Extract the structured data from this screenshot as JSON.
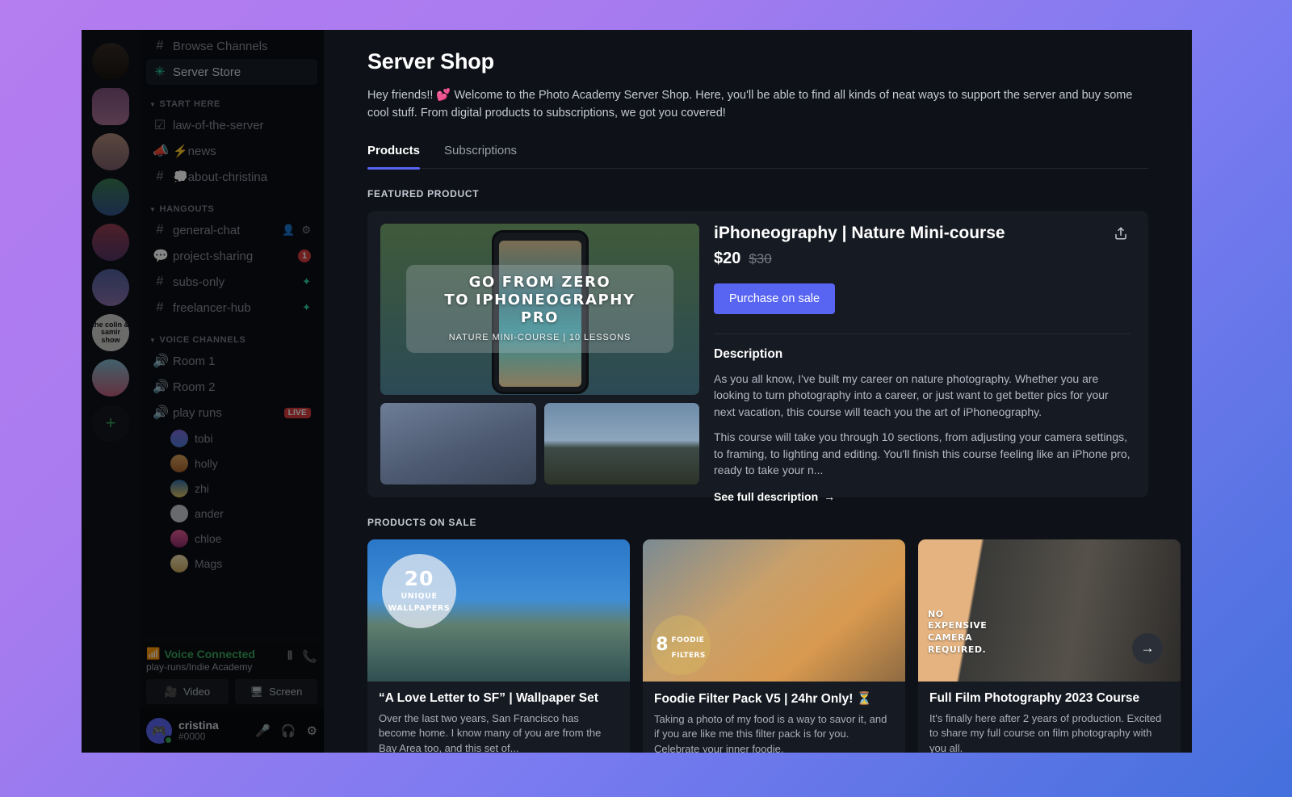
{
  "sidebar": {
    "servers": [
      {
        "name": "server-avatar-1",
        "label": ""
      },
      {
        "name": "server-avatar-2",
        "label": ""
      },
      {
        "name": "server-avatar-3",
        "label": ""
      },
      {
        "name": "server-avatar-4",
        "label": ""
      },
      {
        "name": "server-avatar-5",
        "label": ""
      },
      {
        "name": "server-avatar-6",
        "label": ""
      },
      {
        "name": "server-avatar-colin-samir",
        "label": "the colin & samir show"
      },
      {
        "name": "server-avatar-8",
        "label": ""
      }
    ],
    "add_server_label": "+",
    "top_items": [
      {
        "label": "Browse Channels",
        "icon": "browse-channels-icon",
        "active": false
      },
      {
        "label": "Server Store",
        "icon": "sparkle-icon",
        "active": true
      }
    ],
    "categories": [
      {
        "label": "START HERE",
        "channels": [
          {
            "label": "law-of-the-server",
            "icon": "rules-channel-icon",
            "badge": "",
            "spark": false
          },
          {
            "label": "⚡news",
            "icon": "announcement-channel-icon",
            "badge": "",
            "spark": false
          },
          {
            "label": "💭about-christina",
            "icon": "text-channel-icon",
            "badge": "",
            "spark": false
          }
        ]
      },
      {
        "label": "HANGOUTS",
        "channels": [
          {
            "label": "general-chat",
            "icon": "text-channel-icon",
            "badge": "",
            "spark": false,
            "actions": true
          },
          {
            "label": "project-sharing",
            "icon": "forum-channel-icon",
            "badge": "1",
            "spark": false
          },
          {
            "label": "subs-only",
            "icon": "locked-text-channel-icon",
            "badge": "",
            "spark": true
          },
          {
            "label": "freelancer-hub",
            "icon": "locked-text-channel-icon",
            "badge": "",
            "spark": true
          }
        ]
      },
      {
        "label": "VOICE CHANNELS",
        "channels": [
          {
            "label": "Room 1",
            "icon": "voice-channel-icon",
            "badge": "",
            "spark": false
          },
          {
            "label": "Room 2",
            "icon": "voice-channel-icon",
            "badge": "",
            "spark": false
          },
          {
            "label": "play runs",
            "icon": "voice-channel-icon",
            "badge": "LIVE",
            "spark": false
          }
        ]
      }
    ],
    "voice_members": [
      "tobi",
      "holly",
      "zhi",
      "ander",
      "chloe",
      "Mags"
    ],
    "voice_panel": {
      "status": "Voice Connected",
      "channel_path": "play-runs/Indie Academy",
      "video_label": "Video",
      "screen_label": "Screen"
    },
    "user": {
      "name": "cristina",
      "tag": "#0000"
    }
  },
  "shop": {
    "title": "Server Shop",
    "description": "Hey friends!! 💕 Welcome to the Photo Academy Server Shop. Here, you'll be able to find all kinds of neat ways to support the server and buy some cool stuff. From digital products to subscriptions, we got you covered!",
    "tabs": [
      {
        "label": "Products",
        "active": true
      },
      {
        "label": "Subscriptions",
        "active": false
      }
    ],
    "featured_label": "FEATURED PRODUCT",
    "featured": {
      "name": "iPhoneography | Nature Mini-course",
      "price": "$20",
      "price_original": "$30",
      "buy_label": "Purchase on sale",
      "description_head": "Description",
      "description_p1": "As you all know, I've built my career on nature photography. Whether you are looking to turn photography into a career, or just want to get better pics for your next vacation, this course will teach you the art of iPhoneography.",
      "description_p2": "This course will take you through 10 sections, from adjusting your camera settings, to framing, to lighting and editing. You'll finish this course feeling like an iPhone pro, ready to take your n...",
      "see_full_label": "See full description",
      "hero_overlay_line1": "GO FROM ZERO",
      "hero_overlay_line2": "TO IPHONEOGRAPHY PRO",
      "hero_overlay_sub": "NATURE MINI-COURSE | 10 LESSONS"
    },
    "sale_label": "PRODUCTS ON SALE",
    "sale_products": [
      {
        "title": "“A Love Letter to SF” | Wallpaper Set",
        "description": "Over the last two years, San Francisco has become home. I know many of you are from the Bay Area too, and this set of...",
        "badge_number": "20",
        "badge_line1": "UNIQUE",
        "badge_line2": "WALLPAPERS"
      },
      {
        "title": "Foodie Filter Pack V5 | 24hr Only! ⏳",
        "description": "Taking a photo of my food is a way to savor it, and if you are like me this filter pack is for you. Celebrate your inner foodie.",
        "badge_number": "8",
        "badge_line1": "FOODIE",
        "badge_line2": "FILTERS"
      },
      {
        "title": "Full Film Photography 2023 Course",
        "description": "It's finally here after 2 years of production. Excited to share my full course on film photography with you all.",
        "badge_line1": "NO",
        "badge_line2": "EXPENSIVE",
        "badge_line3": "CAMERA",
        "badge_line4": "REQUIRED."
      }
    ],
    "carousel_next_label": "→"
  },
  "colors": {
    "accent": "#5865f2",
    "sparkle": "#2dd4a7",
    "unread": "#d83c3e",
    "online": "#3ba55d"
  }
}
